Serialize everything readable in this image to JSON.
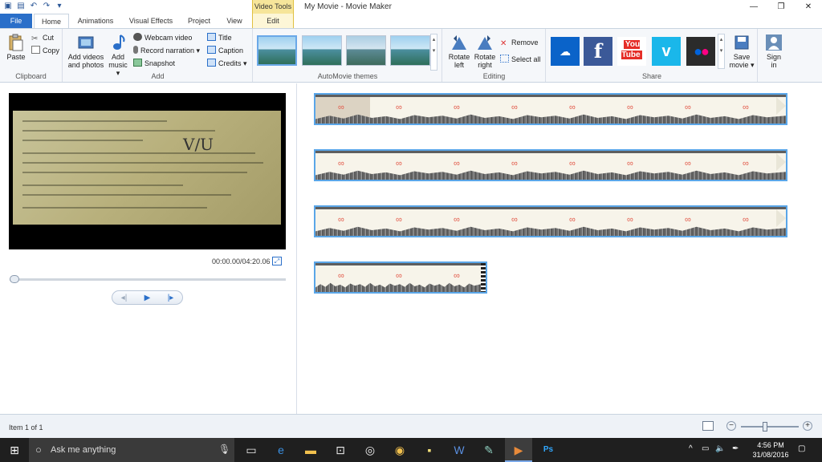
{
  "window": {
    "title": "My Movie - Movie Maker",
    "contextual_group": "Video Tools",
    "controls": [
      "minimize",
      "restore",
      "close"
    ]
  },
  "tabs": [
    {
      "label": "File"
    },
    {
      "label": "Home"
    },
    {
      "label": "Animations"
    },
    {
      "label": "Visual Effects"
    },
    {
      "label": "Project"
    },
    {
      "label": "View"
    },
    {
      "label": "Edit"
    }
  ],
  "ribbon": {
    "clipboard": {
      "label": "Clipboard",
      "paste": "Paste",
      "cut": "Cut",
      "copy": "Copy"
    },
    "add": {
      "label": "Add",
      "add_videos_1": "Add videos",
      "add_videos_2": "and photos",
      "add_music_1": "Add",
      "add_music_2": "music ▾",
      "webcam": "Webcam video",
      "record": "Record narration ▾",
      "snapshot": "Snapshot",
      "title": "Title",
      "caption": "Caption",
      "credits": "Credits ▾"
    },
    "themes": {
      "label": "AutoMovie themes"
    },
    "editing": {
      "label": "Editing",
      "rotate_left_1": "Rotate",
      "rotate_left_2": "left",
      "rotate_right_1": "Rotate",
      "rotate_right_2": "right",
      "remove": "Remove",
      "select_all": "Select all"
    },
    "share": {
      "label": "Share",
      "save_movie_1": "Save",
      "save_movie_2": "movie ▾",
      "sign_in_1": "Sign",
      "sign_in_2": "in",
      "services": [
        {
          "icon": "onedrive-icon",
          "color": "#0a63c9"
        },
        {
          "icon": "facebook-icon",
          "color": "#3b5998"
        },
        {
          "icon": "youtube-icon",
          "color": "#e52d27"
        },
        {
          "icon": "vimeo-icon",
          "color": "#1ab7ea"
        },
        {
          "icon": "flickr-icon",
          "color": "#2b2b2b"
        }
      ],
      "youtube_text": "You Tube"
    }
  },
  "preview": {
    "timecode": "00:00.00/04:20.06",
    "progress_fraction": 0.0,
    "certificate_text": "V/U"
  },
  "storyboard": {
    "clips": [
      {
        "selected": true
      },
      {
        "selected": false
      },
      {
        "selected": false
      },
      {
        "selected": false
      }
    ]
  },
  "statusbar": {
    "item_text": "Item 1 of 1"
  },
  "taskbar": {
    "search_placeholder": "Ask me anything",
    "time": "4:56 PM",
    "date": "31/08/2016",
    "apps": [
      "task-view-icon",
      "edge-icon",
      "file-explorer-icon",
      "store-icon",
      "groove-icon",
      "chrome-icon",
      "sticky-notes-icon",
      "word-icon",
      "notepad-icon",
      "movie-maker-icon",
      "photoshop-icon"
    ]
  }
}
